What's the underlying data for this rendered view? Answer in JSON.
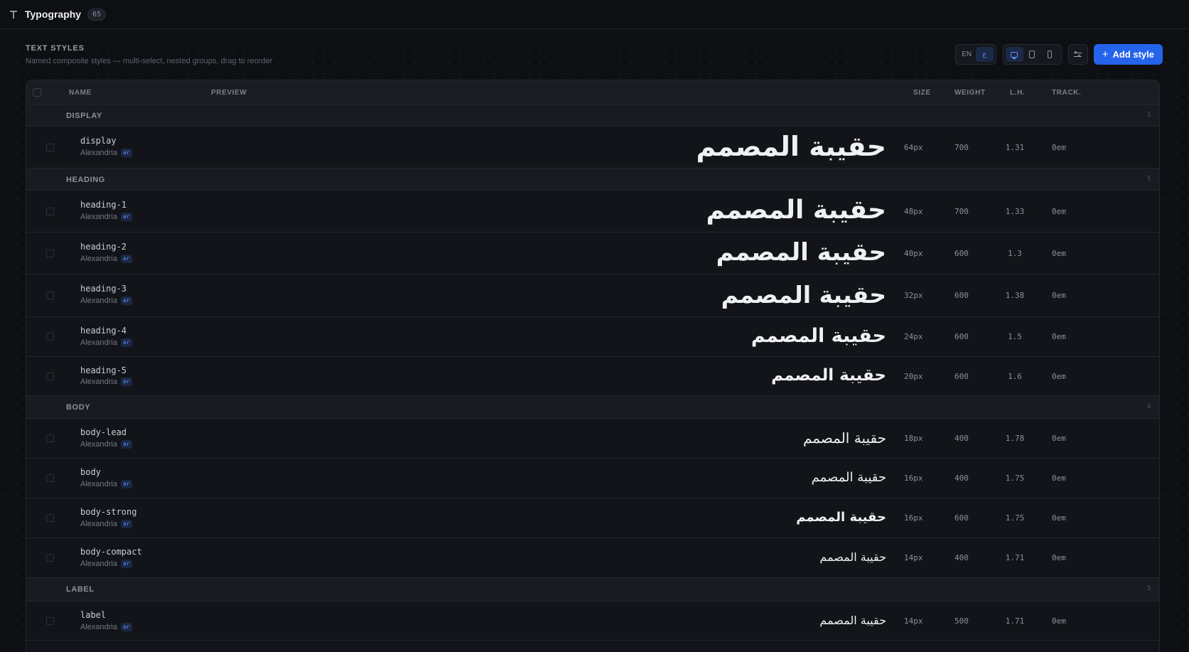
{
  "header": {
    "title": "Typography",
    "count": "65"
  },
  "section": {
    "title": "TEXT STYLES",
    "description": "Named composite styles — multi-select, nested groups, drag to reorder"
  },
  "controls": {
    "lang_en": "EN",
    "lang_ar": "ع",
    "add_label": "Add style"
  },
  "columns": {
    "name": "NAME",
    "preview": "PREVIEW",
    "size": "SIZE",
    "weight": "WEIGHT",
    "lh": "L.H.",
    "track": "TRACK."
  },
  "preview_text": "حقيبة المصمم",
  "groups": [
    {
      "name": "DISPLAY",
      "count": "1"
    },
    {
      "name": "HEADING",
      "count": "5"
    },
    {
      "name": "BODY",
      "count": "4"
    },
    {
      "name": "LABEL",
      "count": "5"
    }
  ],
  "styles": [
    {
      "name": "display",
      "font": "Alexandria",
      "lang": "ar",
      "size": "64px",
      "weight": "700",
      "lh": "1.31",
      "track": "0em"
    },
    {
      "name": "heading-1",
      "font": "Alexandria",
      "lang": "ar",
      "size": "48px",
      "weight": "700",
      "lh": "1.33",
      "track": "0em"
    },
    {
      "name": "heading-2",
      "font": "Alexandria",
      "lang": "ar",
      "size": "40px",
      "weight": "600",
      "lh": "1.3",
      "track": "0em"
    },
    {
      "name": "heading-3",
      "font": "Alexandria",
      "lang": "ar",
      "size": "32px",
      "weight": "600",
      "lh": "1.38",
      "track": "0em"
    },
    {
      "name": "heading-4",
      "font": "Alexandria",
      "lang": "ar",
      "size": "24px",
      "weight": "600",
      "lh": "1.5",
      "track": "0em"
    },
    {
      "name": "heading-5",
      "font": "Alexandria",
      "lang": "ar",
      "size": "20px",
      "weight": "600",
      "lh": "1.6",
      "track": "0em"
    },
    {
      "name": "body-lead",
      "font": "Alexandria",
      "lang": "ar",
      "size": "18px",
      "weight": "400",
      "lh": "1.78",
      "track": "0em"
    },
    {
      "name": "body",
      "font": "Alexandria",
      "lang": "ar",
      "size": "16px",
      "weight": "400",
      "lh": "1.75",
      "track": "0em"
    },
    {
      "name": "body-strong",
      "font": "Alexandria",
      "lang": "ar",
      "size": "16px",
      "weight": "600",
      "lh": "1.75",
      "track": "0em"
    },
    {
      "name": "body-compact",
      "font": "Alexandria",
      "lang": "ar",
      "size": "14px",
      "weight": "400",
      "lh": "1.71",
      "track": "0em"
    },
    {
      "name": "label",
      "font": "Alexandria",
      "lang": "ar",
      "size": "14px",
      "weight": "500",
      "lh": "1.71",
      "track": "0em"
    }
  ]
}
